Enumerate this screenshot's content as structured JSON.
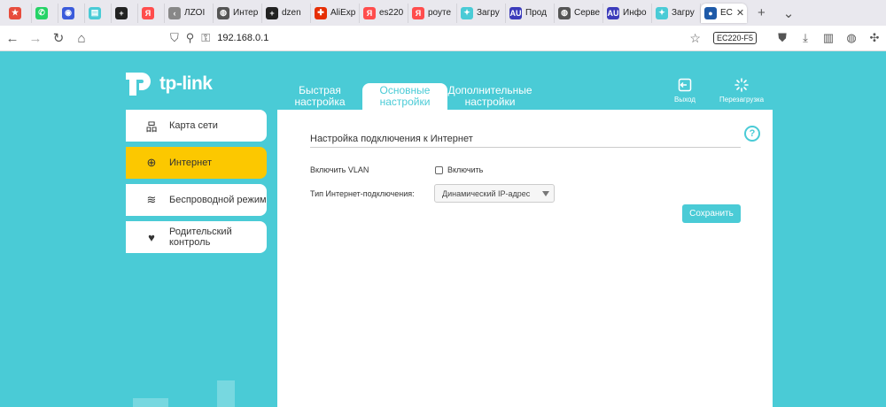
{
  "browser": {
    "tabs": [
      {
        "label": "",
        "fav_color": "#e74c3c",
        "fav_glyph": "★",
        "icon": "star-icon"
      },
      {
        "label": "",
        "fav_color": "#25d366",
        "fav_glyph": "✆",
        "icon": "whatsapp-icon"
      },
      {
        "label": "",
        "fav_color": "#3b5bdb",
        "fav_glyph": "◉",
        "icon": "app-icon"
      },
      {
        "label": "",
        "fav_color": "#4acbd6",
        "fav_glyph": "▤",
        "icon": "doc-icon"
      },
      {
        "label": "",
        "fav_color": "#222222",
        "fav_glyph": "+",
        "icon": "dzen-icon"
      },
      {
        "label": "",
        "fav_color": "#ff4d4d",
        "fav_glyph": "Я",
        "icon": "yandex-icon"
      },
      {
        "label": "ЛZOI",
        "fav_color": "#888888",
        "fav_glyph": "‹",
        "icon": "ozon-icon"
      },
      {
        "label": "Интер",
        "fav_color": "#555555",
        "fav_glyph": "◍",
        "icon": "globe-icon"
      },
      {
        "label": "dzen",
        "fav_color": "#222222",
        "fav_glyph": "+",
        "icon": "dzen-icon"
      },
      {
        "label": "AliExp",
        "fav_color": "#e62e04",
        "fav_glyph": "✚",
        "icon": "aliexpress-icon"
      },
      {
        "label": "es220",
        "fav_color": "#ff4d4d",
        "fav_glyph": "Я",
        "icon": "yandex-icon"
      },
      {
        "label": "роуте",
        "fav_color": "#ff4d4d",
        "fav_glyph": "Я",
        "icon": "yandex-icon"
      },
      {
        "label": "Загру",
        "fav_color": "#4acbd6",
        "fav_glyph": "✦",
        "icon": "download-icon"
      },
      {
        "label": "Прод",
        "fav_color": "#3b3bbb",
        "fav_glyph": "AU",
        "icon": "audit-icon"
      },
      {
        "label": "Серве",
        "fav_color": "#555555",
        "fav_glyph": "◍",
        "icon": "globe-icon"
      },
      {
        "label": "Инфо",
        "fav_color": "#3b3bbb",
        "fav_glyph": "AU",
        "icon": "audit-icon"
      },
      {
        "label": "Загру",
        "fav_color": "#4acbd6",
        "fav_glyph": "✦",
        "icon": "download-icon"
      },
      {
        "label": "EC",
        "fav_color": "#1e5aa8",
        "fav_glyph": "●",
        "icon": "tplink-icon",
        "active": true
      }
    ],
    "url": "192.168.0.1",
    "ext_badge": "EC220-F5"
  },
  "router": {
    "brand": "tp-link",
    "top_tabs": [
      {
        "label": "Быстрая настройка"
      },
      {
        "label": "Основные настройки",
        "active": true
      },
      {
        "label": "Дополнительные настройки"
      }
    ],
    "exit_label": "Выход",
    "reboot_label": "Перезагрузка",
    "sidebar": [
      {
        "label": "Карта сети",
        "icon": "network-map-icon",
        "glyph": "品"
      },
      {
        "label": "Интернет",
        "icon": "globe-icon",
        "glyph": "⊕",
        "active": true
      },
      {
        "label": "Беспроводной режим",
        "icon": "wifi-icon",
        "glyph": "≋"
      },
      {
        "label": "Родительский контроль",
        "icon": "heart-shield-icon",
        "glyph": "♥"
      }
    ],
    "section_title": "Настройка подключения к Интернет",
    "vlan_label": "Включить VLAN",
    "vlan_checkbox_label": "Включить",
    "vlan_checked": false,
    "conn_type_label": "Тип Интернет-подключения:",
    "conn_type_value": "Динамический IP-адрес",
    "save_label": "Сохранить"
  },
  "colors": {
    "accent": "#4acbd6",
    "active_nav": "#fcc800"
  }
}
